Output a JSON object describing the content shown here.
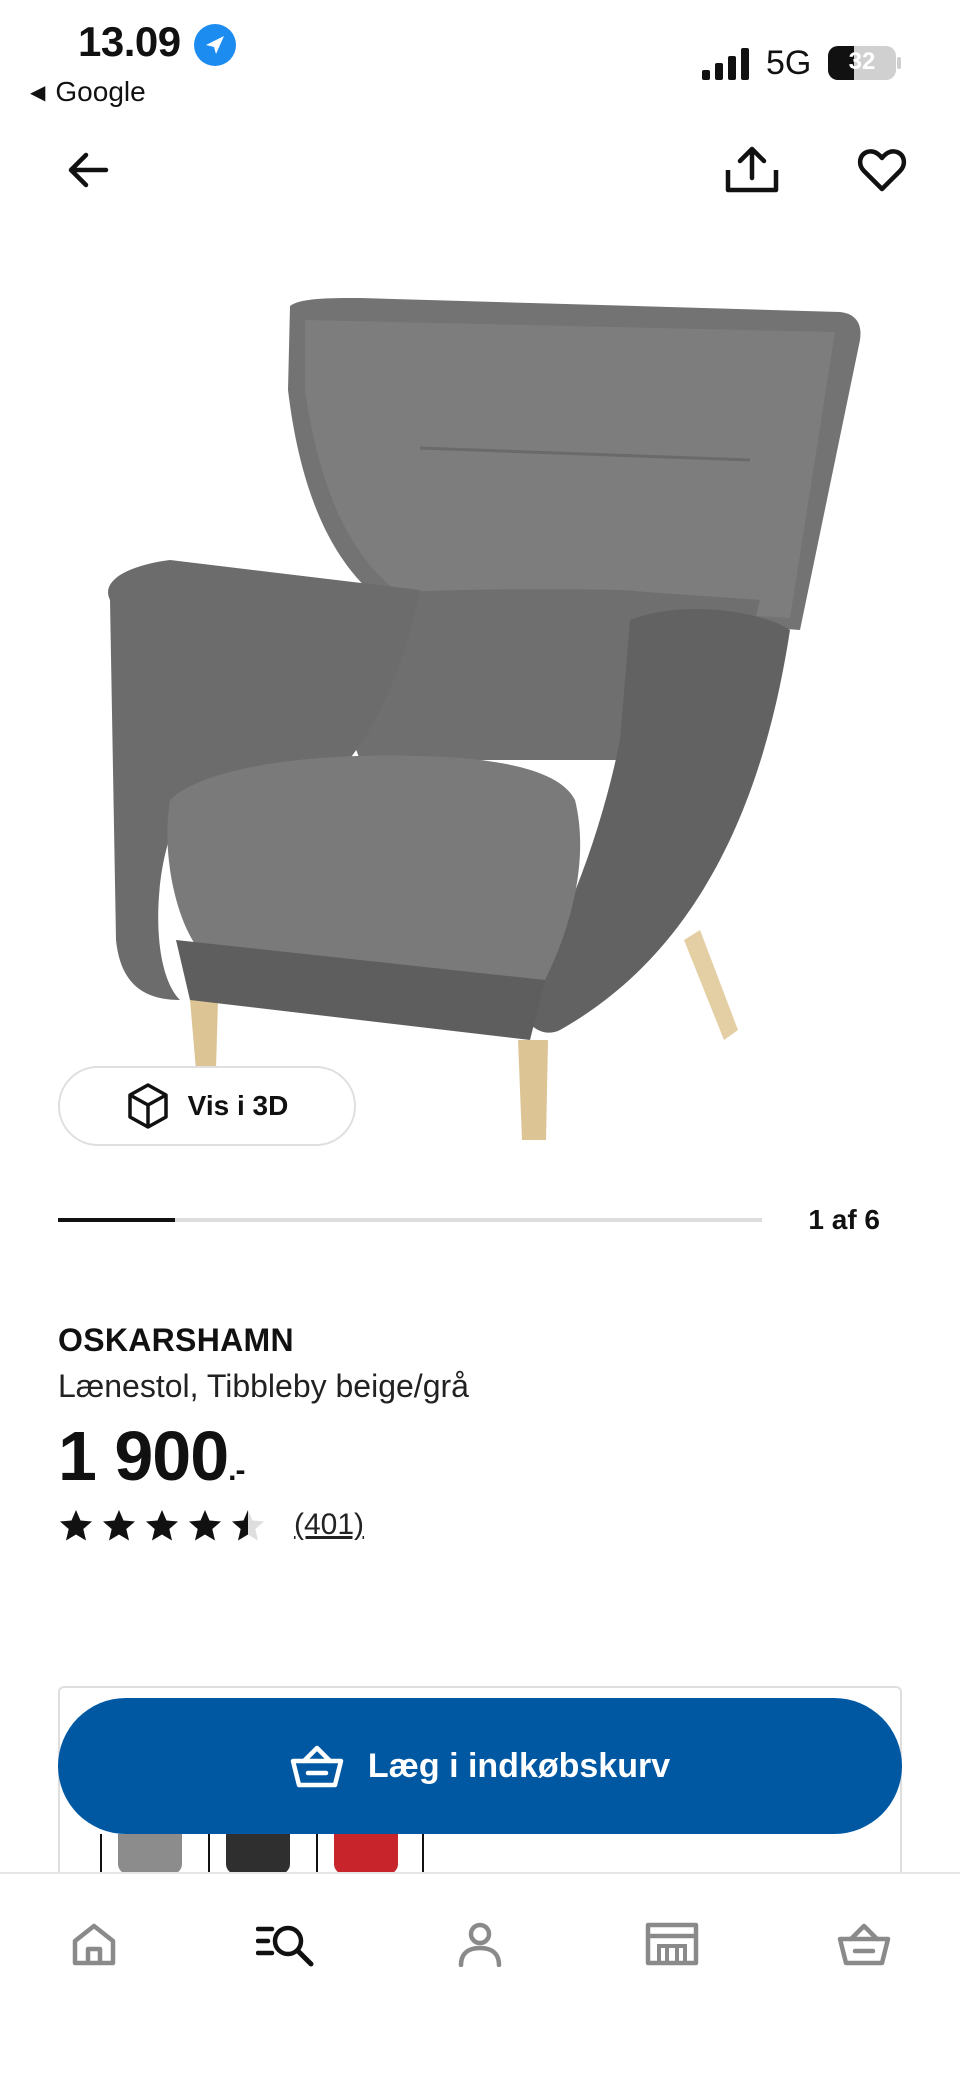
{
  "status_bar": {
    "time": "13.09",
    "back_app": "Google",
    "network": "5G",
    "battery": "32"
  },
  "icons": {
    "location": "location-arrow-icon",
    "back": "arrow-left-icon",
    "share": "share-icon",
    "favorite": "heart-icon",
    "view3d": "cube-icon",
    "cart": "basket-icon"
  },
  "gallery": {
    "view_3d_label": "Vis i 3D",
    "counter": "1 af 6",
    "current": 1,
    "total": 6
  },
  "product": {
    "name": "OSKARSHAMN",
    "description": "Lænestol, Tibbleby beige/grå",
    "price": "1 900",
    "price_suffix": ".-",
    "rating": 4.5,
    "rating_max": 5,
    "review_count": "(401)"
  },
  "purchase": {
    "add_to_cart_label": "Læg i indkøbskurv",
    "variant_colors": [
      "#8c8c8c",
      "#2f2f2f",
      "#c8242c"
    ]
  },
  "bottom_nav": {
    "items": [
      "home-icon",
      "search-icon",
      "profile-icon",
      "store-icon",
      "basket-icon"
    ]
  },
  "colors": {
    "primary": "#0058a3",
    "text": "#111111",
    "location_blue": "#1d8cf0"
  }
}
